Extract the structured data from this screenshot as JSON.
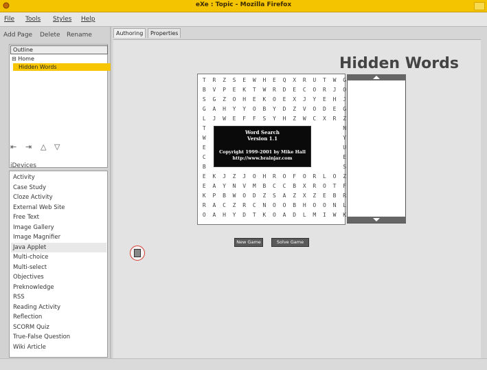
{
  "window": {
    "title": "eXe : Topic - Mozilla Firefox"
  },
  "menu": {
    "file": "File",
    "tools": "Tools",
    "styles": "Styles",
    "help": "Help"
  },
  "page_toolbar": {
    "add_page": "Add Page",
    "delete": "Delete",
    "rename": "Rename"
  },
  "outline": {
    "header": "Outline",
    "home": "Home",
    "current_page": "Hidden Words"
  },
  "idevices": {
    "header": "iDevices",
    "items": [
      "Activity",
      "Case Study",
      "Cloze Activity",
      "External Web Site",
      "Free Text",
      "Image Gallery",
      "Image Magnifier",
      "Java Applet",
      "Multi-choice",
      "Multi-select",
      "Objectives",
      "Preknowledge",
      "RSS",
      "Reading Activity",
      "Reflection",
      "SCORM Quiz",
      "True-False Question",
      "Wiki Article"
    ],
    "selected": "Java Applet"
  },
  "tabs": {
    "authoring": "Authoring",
    "properties": "Properties"
  },
  "content": {
    "heading": "Hidden Words"
  },
  "word_search": {
    "grid": [
      "TRZSEWHEQXRUTWG",
      "BVPEKTWRDECORJO",
      "SGZOHEKOEXJYEHJ",
      "GAHYYOBYDZVODEG",
      "LJWEFFSYHZWCXRZ",
      "T             N",
      "W             Y",
      "E             U",
      "C             E",
      "B             S",
      "EKJZJOHROFORLOZ",
      "EAYNVMBCCBXROTF",
      "KPBWODZSAZXZEBR",
      "RACZRCNOOBHOONL",
      "OAHYDTKOADLMIWK"
    ],
    "splash_line1": "Word Search",
    "splash_line2": "Version 1.1",
    "splash_line3": "Copyright 1999-2001 by Mike Hall",
    "splash_line4": "http://www.brainjar.com",
    "new_game": "New Game",
    "solve_game": "Solve Game"
  },
  "colors": {
    "titlebar": "#f5c400",
    "selection": "#f7c600"
  }
}
